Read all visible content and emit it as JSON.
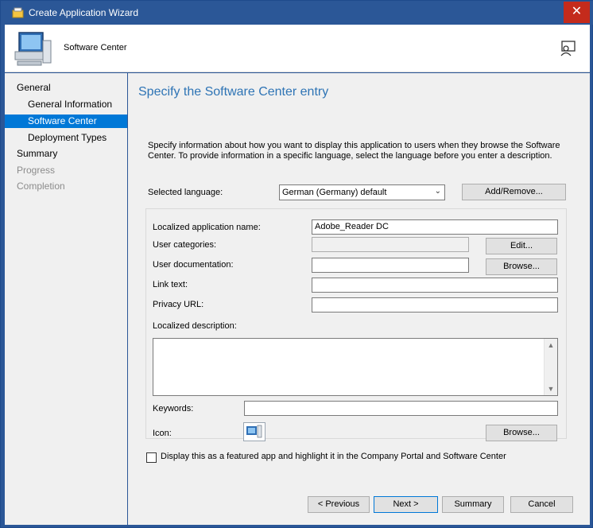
{
  "window": {
    "title": "Create Application Wizard",
    "close_glyph": "✕"
  },
  "header": {
    "title": "Software Center"
  },
  "nav": {
    "items": [
      {
        "label": "General",
        "level": 1,
        "state": "normal"
      },
      {
        "label": "General Information",
        "level": 2,
        "state": "normal"
      },
      {
        "label": "Software Center",
        "level": 2,
        "state": "active"
      },
      {
        "label": "Deployment Types",
        "level": 2,
        "state": "normal"
      },
      {
        "label": "Summary",
        "level": 1,
        "state": "normal"
      },
      {
        "label": "Progress",
        "level": 1,
        "state": "disabled"
      },
      {
        "label": "Completion",
        "level": 1,
        "state": "disabled"
      }
    ]
  },
  "main": {
    "page_title": "Specify the Software Center entry",
    "description": "Specify information about how you want to display this application to users when they browse the Software Center. To provide information in a specific language, select the language before you enter a description.",
    "selected_language_label": "Selected language:",
    "selected_language_value": "German (Germany) default",
    "add_remove_label": "Add/Remove...",
    "localized_app_name_label": "Localized application name:",
    "localized_app_name_value": "Adobe_Reader DC",
    "user_categories_label": "User categories:",
    "user_categories_value": "",
    "edit_label": "Edit...",
    "user_documentation_label": "User documentation:",
    "user_documentation_value": "",
    "browse_label": "Browse...",
    "link_text_label": "Link text:",
    "link_text_value": "",
    "privacy_url_label": "Privacy URL:",
    "privacy_url_value": "",
    "localized_description_label": "Localized description:",
    "localized_description_value": "",
    "keywords_label": "Keywords:",
    "keywords_value": "",
    "icon_label": "Icon:",
    "icon_browse_label": "Browse...",
    "featured_checkbox_label": "Display this as a featured app and highlight it in the Company Portal and Software Center",
    "featured_checked": false
  },
  "footer": {
    "previous_label": "< Previous",
    "next_label": "Next >",
    "summary_label": "Summary",
    "cancel_label": "Cancel"
  },
  "colors": {
    "titlebar": "#2b5797",
    "close": "#c42b1c",
    "accent": "#0078d7",
    "page_title": "#2e74b5"
  },
  "icons": {
    "title": "wizard-app-icon",
    "header": "computer-monitor-icon",
    "help": "help-person-icon"
  }
}
